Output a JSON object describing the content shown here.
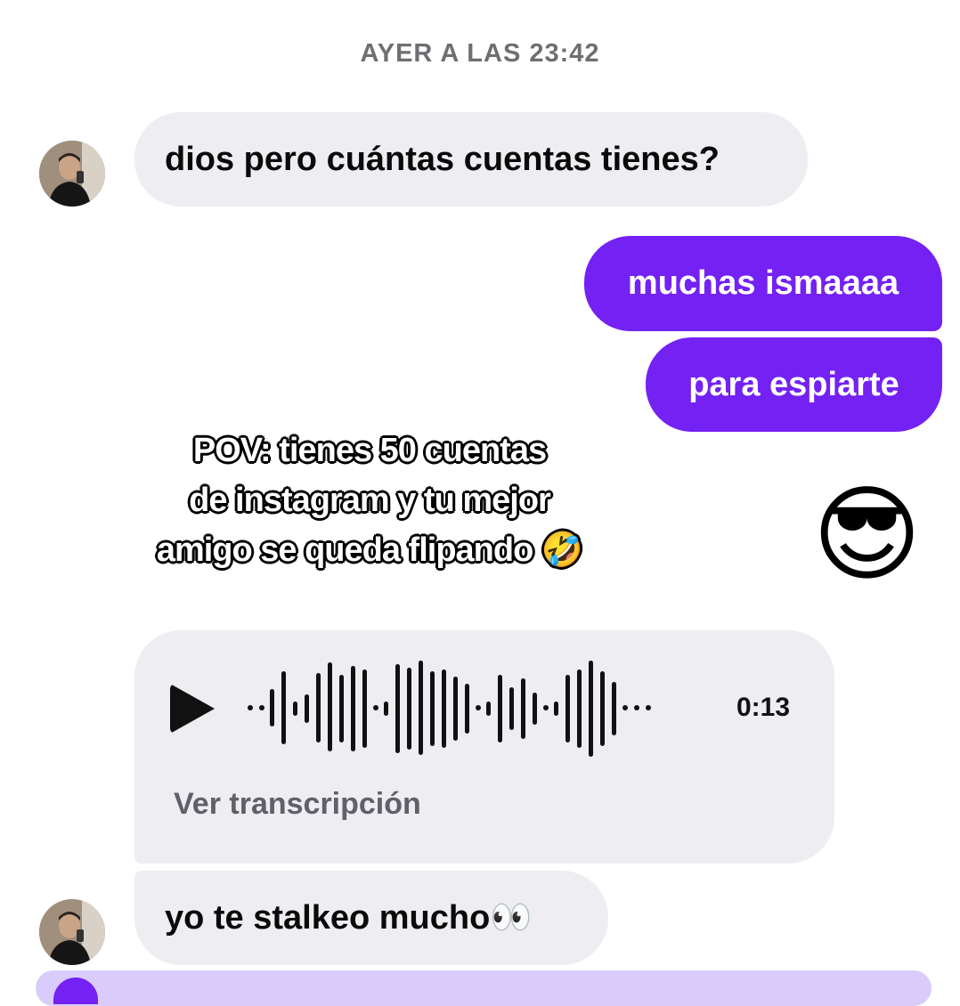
{
  "timestamp": "AYER A LAS 23:42",
  "messages": {
    "m1": "dios pero cuántas cuentas tienes?",
    "m2": "muchas ismaaaa",
    "m3": "para espiarte",
    "m4": "😎",
    "m6": "yo te stalkeo mucho👀"
  },
  "voice": {
    "duration": "0:13",
    "transcription_label": "Ver transcripción"
  },
  "overlay": {
    "line1": "POV: tienes 50 cuentas",
    "line2": "de instagram y tu mejor",
    "line3": "amigo se queda flipando 🤣"
  },
  "colors": {
    "sent_bubble": "#7421f3",
    "received_bubble": "#eeeef2",
    "timestamp_text": "#6f6f73"
  },
  "icons": {
    "play": "play-icon",
    "avatar": "profile-photo"
  }
}
